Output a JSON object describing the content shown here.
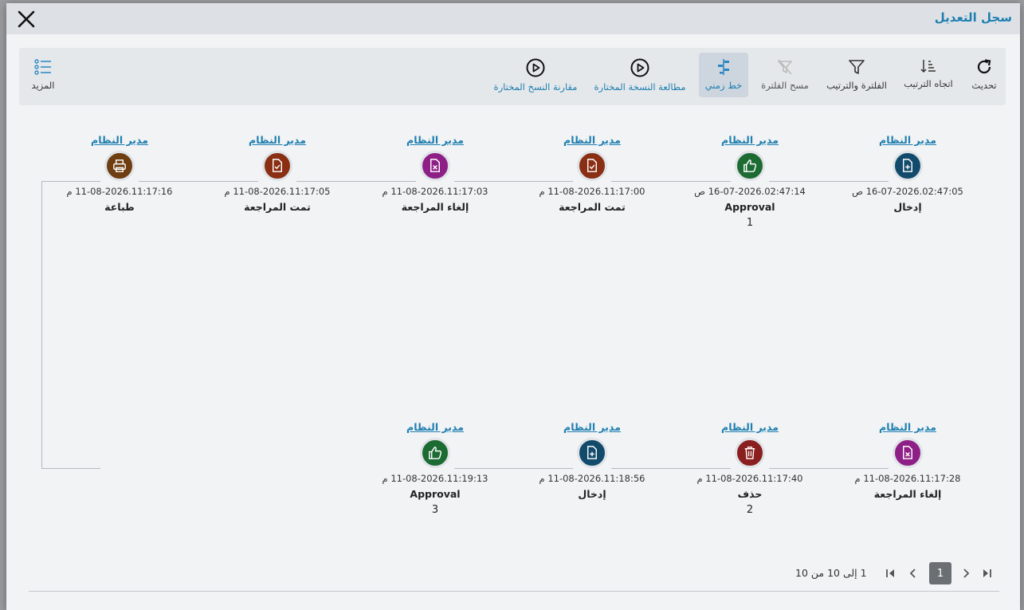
{
  "dialog": {
    "title": "سجل التعديل"
  },
  "toolbar": {
    "refresh": "تحديث",
    "sort_direction": "اتجاه الترتيب",
    "filter_sort": "الفلترة والترتيب",
    "clear_filter": "مسح الفلترة",
    "timeline": "خط زمني",
    "view_selected": "مطالعة النسخة المختارة",
    "compare_selected": "مقارنة النسخ المختارة",
    "more": "المزيد"
  },
  "timeline_events": [
    {
      "user": "مدير النظام",
      "date": "16-07-2026.02:47:05 ص",
      "action": "إدخال",
      "version": "",
      "icon": "document-add-icon",
      "color": "#124a6b"
    },
    {
      "user": "مدير النظام",
      "date": "16-07-2026.02:47:14 ص",
      "action": "Approval",
      "version": "1",
      "icon": "thumbs-up-icon",
      "color": "#1c6b33"
    },
    {
      "user": "مدير النظام",
      "date": "11-08-2026.11:17:00 م",
      "action": "تمت المراجعة",
      "version": "",
      "icon": "document-check-icon",
      "color": "#8a2f14"
    },
    {
      "user": "مدير النظام",
      "date": "11-08-2026.11:17:03 م",
      "action": "إلغاء المراجعة",
      "version": "",
      "icon": "document-x-icon",
      "color": "#8e1f86"
    },
    {
      "user": "مدير النظام",
      "date": "11-08-2026.11:17:05 م",
      "action": "تمت المراجعة",
      "version": "",
      "icon": "document-check-icon",
      "color": "#8a2f14"
    },
    {
      "user": "مدير النظام",
      "date": "11-08-2026.11:17:16 م",
      "action": "طباعة",
      "version": "",
      "icon": "printer-icon",
      "color": "#6e3d10"
    },
    {
      "user": "مدير النظام",
      "date": "11-08-2026.11:17:28 م",
      "action": "إلغاء المراجعة",
      "version": "",
      "icon": "document-x-icon",
      "color": "#8e1f86"
    },
    {
      "user": "مدير النظام",
      "date": "11-08-2026.11:17:40 م",
      "action": "حذف",
      "version": "2",
      "icon": "trash-icon",
      "color": "#8a1f1f"
    },
    {
      "user": "مدير النظام",
      "date": "11-08-2026.11:18:56 م",
      "action": "إدخال",
      "version": "",
      "icon": "document-add-icon",
      "color": "#124a6b"
    },
    {
      "user": "مدير النظام",
      "date": "11-08-2026.11:19:13 م",
      "action": "Approval",
      "version": "3",
      "icon": "thumbs-up-icon",
      "color": "#1c6b33"
    }
  ],
  "pagination": {
    "current_page": "1",
    "info": "1 إلى 10 من 10"
  }
}
